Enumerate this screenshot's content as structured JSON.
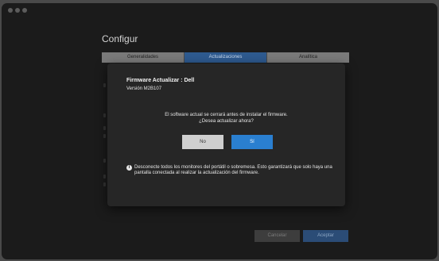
{
  "window": {
    "title": "Configur"
  },
  "tabs": [
    {
      "label": "Generalidades",
      "active": false
    },
    {
      "label": "Actualizaciones",
      "active": true
    },
    {
      "label": "Analítica",
      "active": false
    }
  ],
  "footer": {
    "cancel_label": "Cancelar",
    "accept_label": "Aceptar"
  },
  "dialog": {
    "title": "Firmware Actualizar : Dell",
    "version": "Versión M2B107",
    "message_line1": "El software actual se cerrará antes de instalar el firmware.",
    "message_line2": "¿Desea actualizar ahora?",
    "no_label": "No",
    "yes_label": "Sí",
    "info_glyph": "i",
    "note": "Desconecte todos los monitores del portátil o sobremesa. Esto garantizará que solo haya una pantalla conectada al realizar la actualización del firmware."
  },
  "colors": {
    "accent": "#2a7fd0",
    "active_tab": "#2e5a8f",
    "dialog_bg": "#262626"
  }
}
